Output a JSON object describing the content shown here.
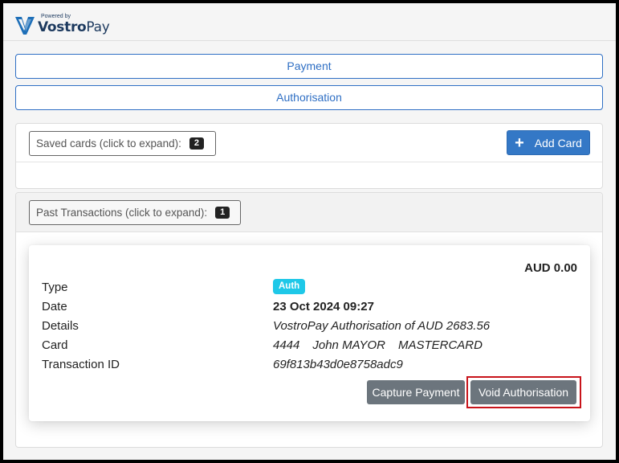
{
  "brand": {
    "powered_by": "Powered by",
    "name_bold": "Vostro",
    "name_regular": "Pay",
    "mark_color": "#1e6fb8"
  },
  "tabs": {
    "payment": "Payment",
    "authorisation": "Authorisation"
  },
  "saved_cards": {
    "label": "Saved cards (click to expand):",
    "count": "2",
    "add_button_icon": "plus-icon",
    "add_button_label": "Add Card"
  },
  "past_transactions": {
    "label": "Past Transactions (click to expand):",
    "count": "1",
    "transaction": {
      "amount": "AUD 0.00",
      "fields": {
        "type_label": "Type",
        "type_badge": "Auth",
        "date_label": "Date",
        "date_value": "23 Oct 2024 09:27",
        "details_label": "Details",
        "details_value": "VostroPay Authorisation of AUD 2683.56",
        "card_label": "Card",
        "card_last4": "4444",
        "card_holder": "John MAYOR",
        "card_brand": "MASTERCARD",
        "txn_id_label": "Transaction ID",
        "txn_id_value": "69f813b43d0e8758adc9"
      },
      "actions": {
        "capture": "Capture Payment",
        "void": "Void Authorisation"
      }
    }
  },
  "colors": {
    "primary": "#3478c6",
    "tab_border": "#2f6fc4",
    "auth_badge": "#1ec8e8",
    "secondary_button": "#6c757d",
    "highlight": "#c8141b"
  }
}
